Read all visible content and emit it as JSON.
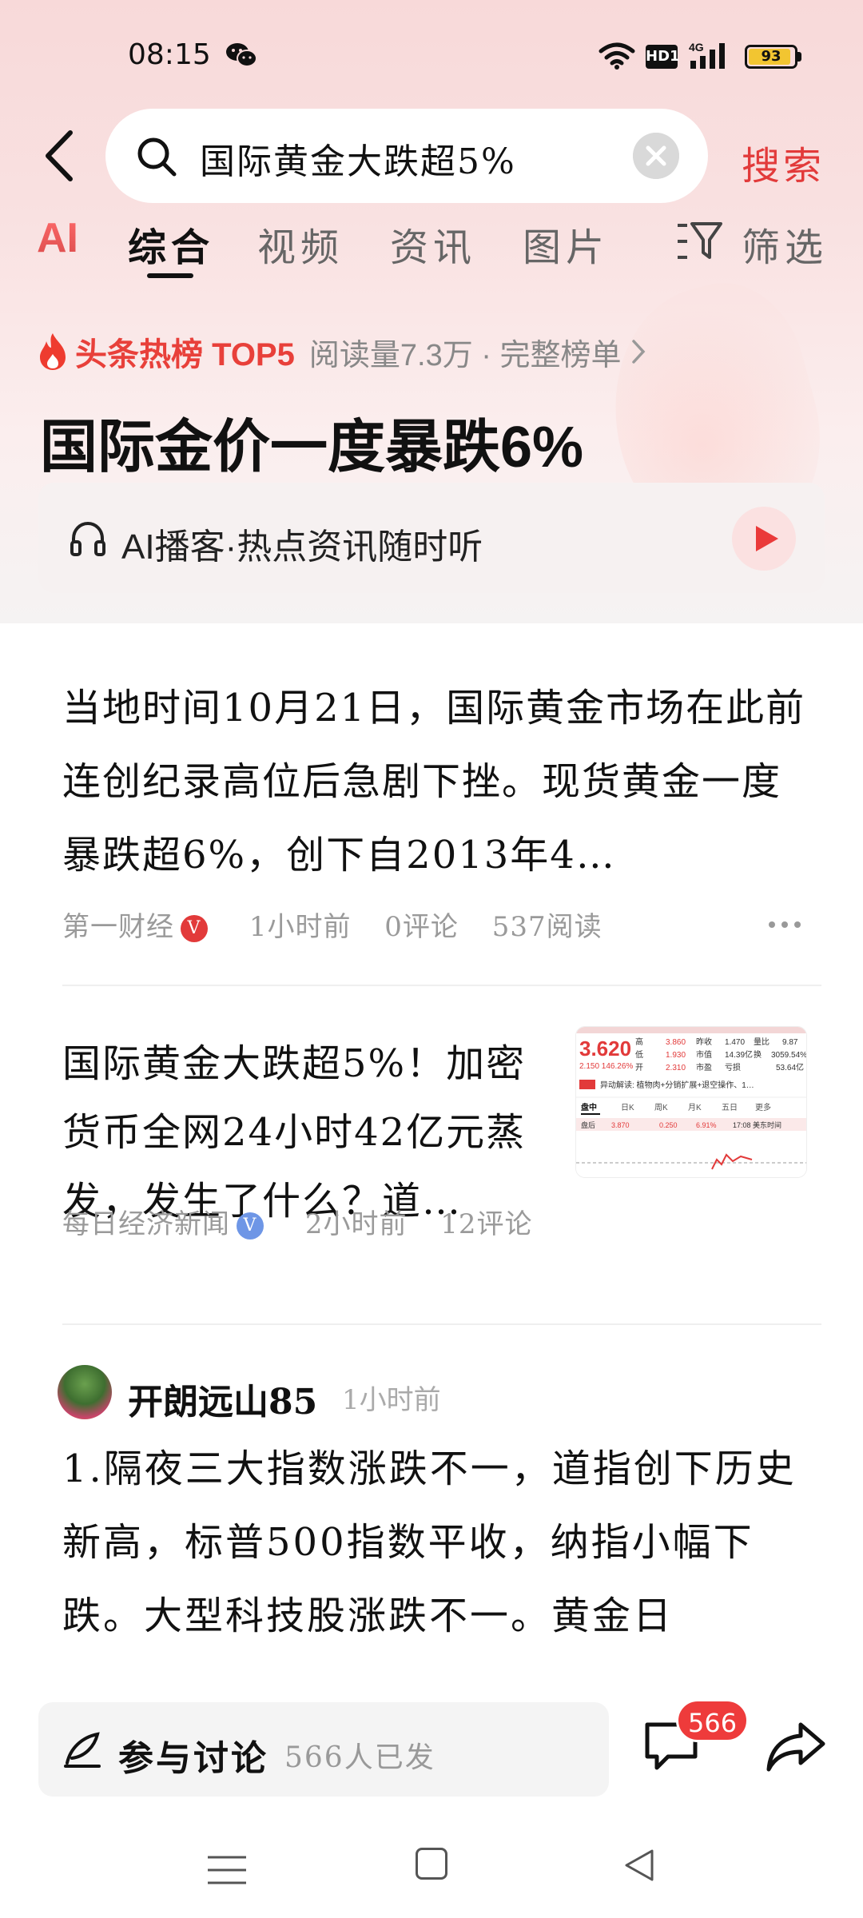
{
  "status": {
    "time": "08:15",
    "network_hd": "HD1",
    "network_type": "4G",
    "battery": "93",
    "battery_level": 0.93
  },
  "search": {
    "query": "国际黄金大跌超5%",
    "button_label": "搜索"
  },
  "tabs": {
    "ai_label": "AI",
    "items": [
      "综合",
      "视频",
      "资讯",
      "图片"
    ],
    "active_index": 0,
    "filter_label": "筛选"
  },
  "hot": {
    "badge": "头条热榜 TOP5",
    "meta": "阅读量7.3万 · 完整榜单",
    "headline": "国际金价一度暴跌6%"
  },
  "podcast": {
    "label": "AI播客·热点资讯随时听"
  },
  "articles": [
    {
      "text": "当地时间10月21日，国际黄金市场在此前连创纪录高位后急剧下挫。现货黄金一度暴跌超6%，创下自2013年4…",
      "source": "第一财经",
      "verified": "V",
      "time": "1小时前",
      "comments": "0评论",
      "reads": "537阅读"
    },
    {
      "text": "国际黄金大跌超5%！加密货币全网24小时42亿元蒸发，发生了什么？道…",
      "source": "每日经济新闻",
      "verified": "V",
      "time": "2小时前",
      "comments": "12评论",
      "thumb": {
        "price": "3.620",
        "change": "2.150  146.26%",
        "rows": [
          [
            "高",
            "3.860",
            "昨收",
            "1.470",
            "量比",
            "9.87"
          ],
          [
            "低",
            "1.930",
            "市值",
            "14.39亿",
            "换",
            "3059.54%"
          ],
          [
            "开",
            "2.310",
            "市盈",
            "亏损",
            "",
            "53.64亿"
          ]
        ],
        "news": "异动解读: 植物肉+分销扩展+退空操作、1…",
        "tabs": [
          "盘中",
          "日K",
          "周K",
          "月K",
          "五日",
          "更多"
        ],
        "sub": [
          "盘后",
          "3.870",
          "0.250",
          "6.91%",
          "17:08 美东时间"
        ]
      }
    }
  ],
  "post": {
    "username": "开朗远山85",
    "time": "1小时前",
    "text": "1.隔夜三大指数涨跌不一，道指创下历史新高，标普500指数平收，纳指小幅下跌。大型科技股涨跌不一。黄金日"
  },
  "bottom": {
    "discuss_label": "参与讨论",
    "discuss_count": "566人已发",
    "comment_badge": "566"
  },
  "colors": {
    "accent": "#e23a3a",
    "bg_top": "#f8d9d9"
  }
}
